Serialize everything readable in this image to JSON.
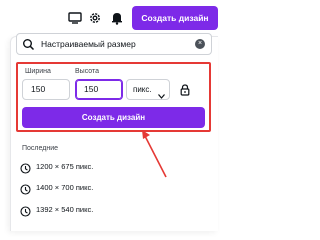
{
  "topbar": {
    "create_design_label": "Создать дизайн",
    "icons": [
      "monitor-icon",
      "gear-icon",
      "bell-icon"
    ]
  },
  "search": {
    "value": "Настраиваемый размер"
  },
  "custom_size": {
    "width_label": "Ширина",
    "width_value": "150",
    "height_label": "Высота",
    "height_value": "150",
    "unit_value": "пикс.",
    "create_label": "Создать дизайн"
  },
  "recent": {
    "title": "Последние",
    "items": [
      {
        "label": "1200 × 675 пикс."
      },
      {
        "label": "1400 × 700 пикс."
      },
      {
        "label": "1392 × 540 пикс."
      }
    ]
  },
  "colors": {
    "accent": "#7d2ae8",
    "highlight": "#e53935"
  }
}
